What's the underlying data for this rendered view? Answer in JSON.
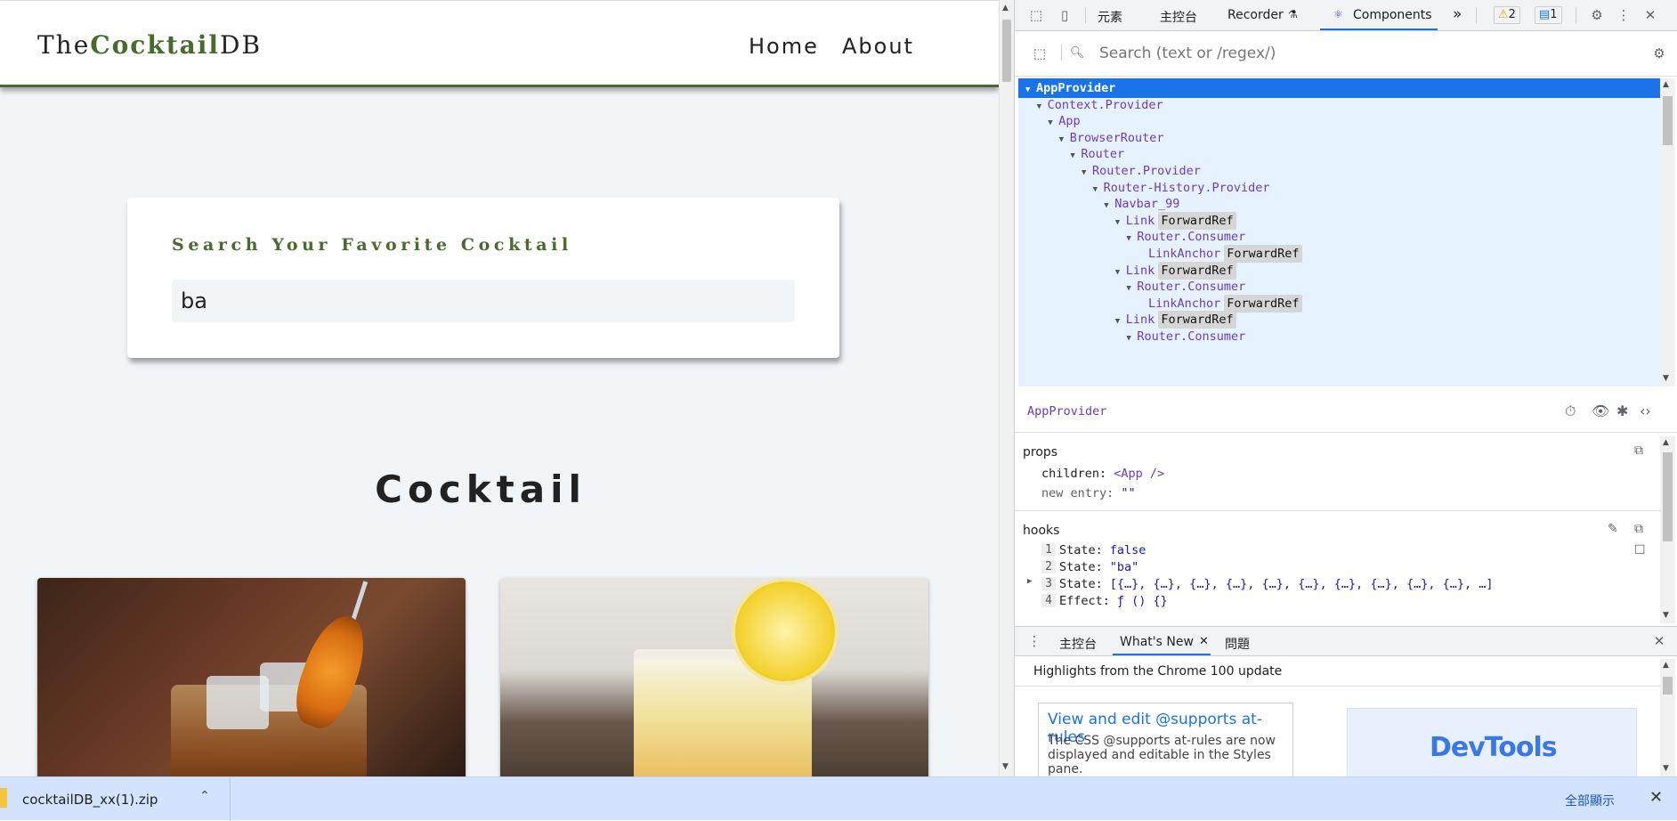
{
  "page": {
    "logo_prefix": "The",
    "logo_bold": "Cocktail",
    "logo_suffix": "DB",
    "nav": {
      "home": "Home",
      "about": "About"
    },
    "search": {
      "label": "Search Your Favorite Cocktail",
      "value": "ba"
    },
    "section_title": "Cocktail"
  },
  "devtools": {
    "tabs": [
      "元素",
      "主控台",
      "Recorder",
      "Components"
    ],
    "more_tabs": "»",
    "warnings": "2",
    "messages": "1",
    "search_placeholder": "Search (text or /regex/)",
    "tree": [
      {
        "name": "AppProvider",
        "depth": 0,
        "tri": true,
        "selected": true
      },
      {
        "name": "Context.Provider",
        "depth": 1,
        "tri": true
      },
      {
        "name": "App",
        "depth": 2,
        "tri": true
      },
      {
        "name": "BrowserRouter",
        "depth": 3,
        "tri": true
      },
      {
        "name": "Router",
        "depth": 4,
        "tri": true
      },
      {
        "name": "Router.Provider",
        "depth": 5,
        "tri": true
      },
      {
        "name": "Router-History.Provider",
        "depth": 6,
        "tri": true
      },
      {
        "name": "Navbar_99",
        "depth": 7,
        "tri": true
      },
      {
        "name": "Link",
        "depth": 8,
        "tri": true,
        "tag": "ForwardRef"
      },
      {
        "name": "Router.Consumer",
        "depth": 9,
        "tri": true
      },
      {
        "name": "LinkAnchor",
        "depth": 10,
        "tri": false,
        "tag": "ForwardRef"
      },
      {
        "name": "Link",
        "depth": 8,
        "tri": true,
        "tag": "ForwardRef"
      },
      {
        "name": "Router.Consumer",
        "depth": 9,
        "tri": true
      },
      {
        "name": "LinkAnchor",
        "depth": 10,
        "tri": false,
        "tag": "ForwardRef"
      },
      {
        "name": "Link",
        "depth": 8,
        "tri": true,
        "tag": "ForwardRef"
      },
      {
        "name": "Router.Consumer",
        "depth": 9,
        "tri": true
      }
    ],
    "inspected": "AppProvider",
    "props_title": "props",
    "props": {
      "children_key": "children:",
      "children_val": "<App />",
      "new_entry_key": "new entry:",
      "new_entry_val": "\"\""
    },
    "hooks_title": "hooks",
    "hooks": [
      {
        "num": "1",
        "label": "State:",
        "value": "false"
      },
      {
        "num": "2",
        "label": "State:",
        "value": "\"ba\""
      },
      {
        "num": "3",
        "label": "State:",
        "value": "[{…}, {…}, {…}, {…}, {…}, {…}, {…}, {…}, {…}, {…}, …]"
      },
      {
        "num": "4",
        "label": "Effect:",
        "value": "ƒ () {}"
      }
    ],
    "drawer_tabs": [
      "主控台",
      "What's New",
      "問題"
    ],
    "whatsnew_head": "Highlights from the Chrome 100 update",
    "feature_title": "View and edit @supports at-rules",
    "feature_desc": "The CSS @supports at-rules are now displayed and editable in the Styles pane.",
    "promo_text": "DevTools"
  },
  "download": {
    "filename": "cocktailDB_xx(1).zip",
    "show_all": "全部顯示"
  }
}
